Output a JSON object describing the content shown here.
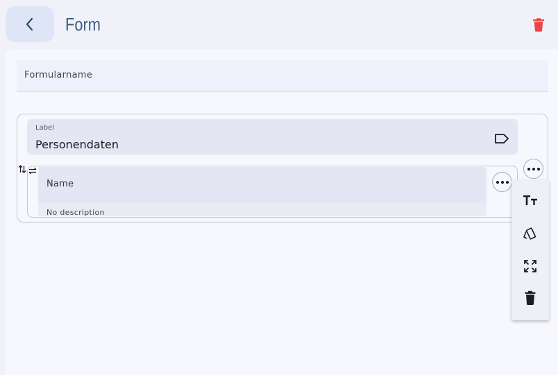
{
  "header": {
    "title": "Form",
    "back_icon": "chevron-left-icon",
    "delete_icon": "trash-icon",
    "delete_color": "#ef4444"
  },
  "form": {
    "name_placeholder": "Formularname"
  },
  "section": {
    "label_caption": "Label",
    "label_value": "Personendaten",
    "label_icon": "label-tag-icon",
    "items": [
      {
        "name": "Name",
        "description": "No description"
      }
    ]
  },
  "context_menu": {
    "items": [
      {
        "icon": "text-size-icon"
      },
      {
        "icon": "cards-icon"
      },
      {
        "icon": "expand-icon"
      },
      {
        "icon": "trash-icon"
      }
    ]
  }
}
